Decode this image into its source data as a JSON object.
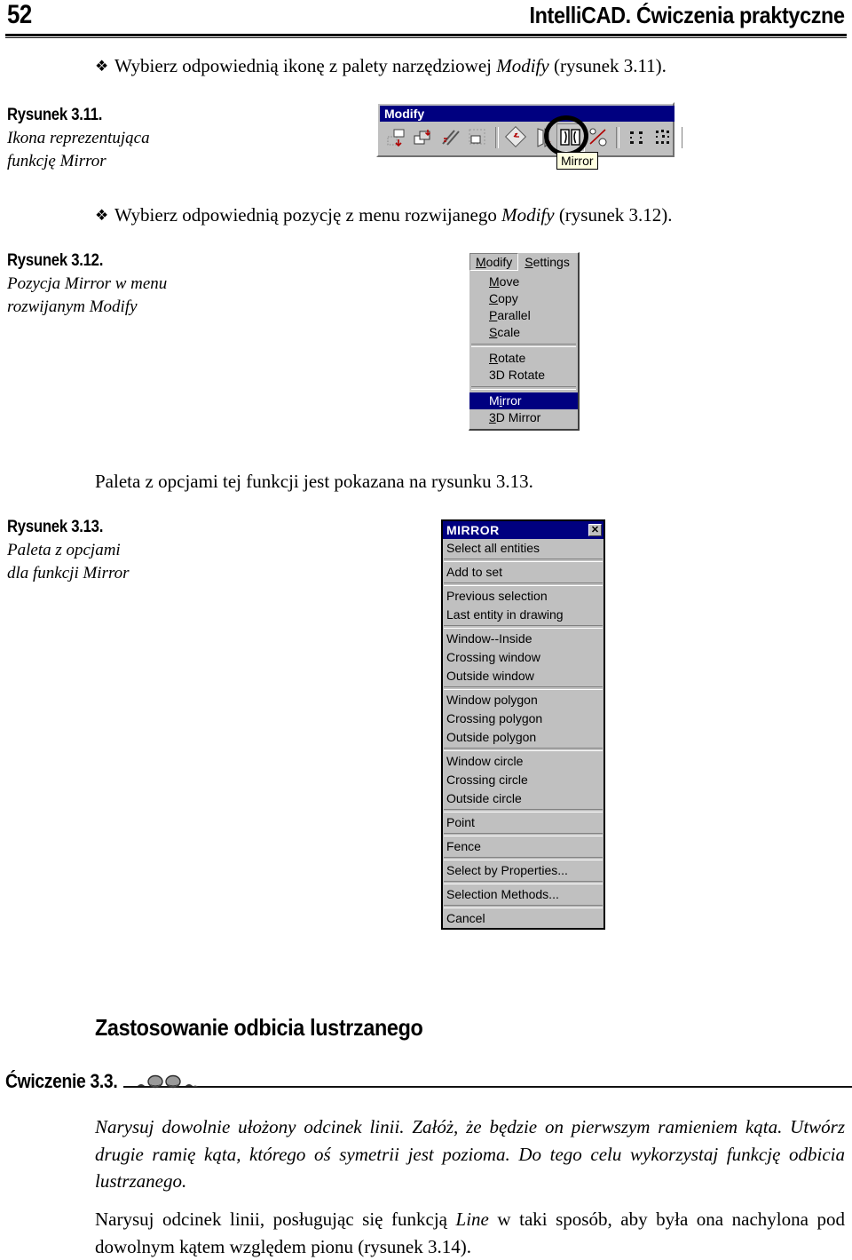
{
  "header": {
    "page_number": "52",
    "title": "IntelliCAD. Ćwiczenia praktyczne"
  },
  "bullets": [
    {
      "glyph": "❖",
      "text_before": "Wybierz odpowiednią ikonę z palety narzędziowej ",
      "emphasis": "Modify",
      "text_after": " (rysunek 3.11)."
    },
    {
      "glyph": "❖",
      "text_before": "Wybierz odpowiednią pozycję z menu rozwijanego ",
      "emphasis": "Modify",
      "text_after": " (rysunek 3.12)."
    }
  ],
  "paragraph_palette": "Paleta z opcjami tej funkcji jest pokazana na rysunku 3.13.",
  "captions": [
    {
      "number": "Rysunek 3.11.",
      "line1": "Ikona reprezentująca",
      "line2": "funkcję Mirror"
    },
    {
      "number": "Rysunek 3.12.",
      "line1": "Pozycja Mirror w menu",
      "line2": "rozwijanym Modify"
    },
    {
      "number": "Rysunek 3.13.",
      "line1": "Paleta z opcjami",
      "line2": "dla funkcji Mirror"
    }
  ],
  "figure_toolbar": {
    "title": "Modify",
    "tooltip": "Mirror",
    "buttons": [
      "move-icon",
      "copy-icon",
      "parallel-icon",
      "scale-icon",
      "separator",
      "rotate-icon",
      "3d-rotate-icon",
      "mirror-icon",
      "3d-mirror-icon",
      "separator",
      "array-icon",
      "3d-array-icon",
      "separator"
    ],
    "highlighted_button": "mirror-icon"
  },
  "figure_menu": {
    "menubar": [
      {
        "label": "Modify",
        "mnemonic": "M",
        "open": true
      },
      {
        "label": "Settings",
        "mnemonic": "S",
        "open": false
      }
    ],
    "items": [
      {
        "label": "Move",
        "mnemonic": "M",
        "type": "item"
      },
      {
        "label": "Copy",
        "mnemonic": "C",
        "type": "item"
      },
      {
        "label": "Parallel",
        "mnemonic": "P",
        "type": "item"
      },
      {
        "label": "Scale",
        "mnemonic": "S",
        "type": "item"
      },
      {
        "type": "separator"
      },
      {
        "label": "Rotate",
        "mnemonic": "R",
        "type": "item"
      },
      {
        "label": "3D Rotate",
        "mnemonic": "",
        "type": "item"
      },
      {
        "type": "separator"
      },
      {
        "label": "Mirror",
        "mnemonic": "i",
        "type": "item",
        "highlighted": true
      },
      {
        "label": "3D Mirror",
        "mnemonic": "3",
        "type": "item"
      }
    ]
  },
  "figure_palette": {
    "title": "MIRROR",
    "close_label": "✕",
    "groups": [
      [
        "Select all entities"
      ],
      [
        "Add to set"
      ],
      [
        "Previous selection",
        "Last entity in drawing"
      ],
      [
        "Window--Inside",
        "Crossing window",
        "Outside window"
      ],
      [
        "Window polygon",
        "Crossing polygon",
        "Outside polygon"
      ],
      [
        "Window circle",
        "Crossing circle",
        "Outside circle"
      ],
      [
        "Point"
      ],
      [
        "Fence"
      ],
      [
        "Select by Properties..."
      ],
      [
        "Selection Methods..."
      ],
      [
        "Cancel"
      ]
    ]
  },
  "section_heading": "Zastosowanie odbicia lustrzanego",
  "exercise": {
    "label": "Ćwiczenie 3.3.",
    "paragraph": "Narysuj dowolnie ułożony odcinek linii. Załóż, że będzie on pierwszym ramieniem kąta. Utwórz drugie ramię kąta, którego oś symetrii jest pozioma. Do tego celu wykorzystaj funkcję odbicia lustrzanego."
  },
  "final_paragraph": {
    "before": "Narysuj odcinek linii, posługując się funkcją ",
    "emphasis": "Line",
    "after": " w taki sposób, aby była ona nachylona pod dowolnym kątem względem pionu (rysunek 3.14)."
  },
  "colors": {
    "titlebar": "#000080",
    "chrome": "#c0c0c0",
    "tooltip": "#ffffe1",
    "text": "#000000"
  }
}
